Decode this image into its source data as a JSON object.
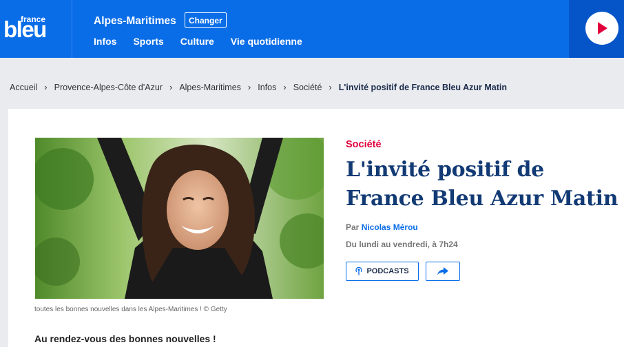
{
  "header": {
    "logo_small": "france",
    "logo_big": "bleu",
    "region": "Alpes-Maritimes",
    "change_label": "Changer",
    "nav": [
      "Infos",
      "Sports",
      "Culture",
      "Vie quotidienne"
    ]
  },
  "player": {
    "icon": "play-icon"
  },
  "breadcrumb": {
    "items": [
      "Accueil",
      "Provence-Alpes-Côte d'Azur",
      "Alpes-Maritimes",
      "Infos",
      "Société"
    ],
    "current": "L'invité positif de France Bleu Azur Matin",
    "separator": "›"
  },
  "article": {
    "category": "Société",
    "title": "L'invité positif de France Bleu Azur Matin",
    "by_prefix": "Par",
    "author": "Nicolas Mérou",
    "schedule": "Du lundi au vendredi, à 7h24",
    "podcasts_label": "PODCASTS",
    "caption": "toutes les bonnes nouvelles dans les Alpes-Maritimes ! © Getty",
    "intro": "Au rendez-vous des bonnes nouvelles !"
  },
  "colors": {
    "brand_blue": "#0a6de8",
    "player_blue": "#0555c9",
    "play_red": "#e2003c",
    "category_red": "#e2003c",
    "title_navy": "#123a74"
  }
}
